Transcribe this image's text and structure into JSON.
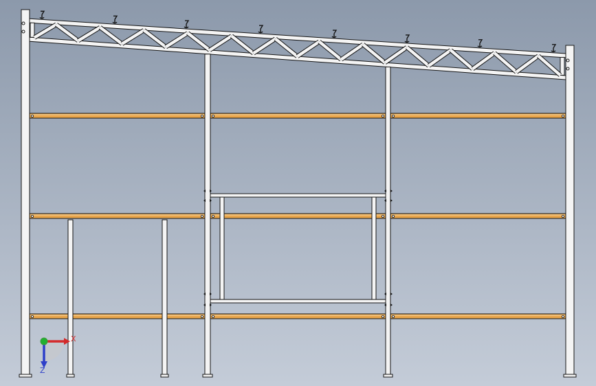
{
  "viewport": {
    "background_top": "#8c99ab",
    "background_bottom": "#c4ccd8"
  },
  "colors": {
    "steel_fill": "#f4f4f4",
    "steel_edge": "#141414",
    "beam_fill": "#e9a64c",
    "beam_highlight": "#f7d9a8",
    "triad_x": "#d42a2a",
    "triad_y": "#21b02f",
    "triad_z": "#2e3fc9",
    "triad_origin": "#3c9a3c"
  },
  "structure": {
    "columns": 6,
    "short_posts": 2,
    "truss_panels": 24,
    "beam_levels": 3,
    "beam_bays": 3,
    "hooks": 8
  },
  "triad": {
    "x_label": "X",
    "z_label": "Z"
  }
}
